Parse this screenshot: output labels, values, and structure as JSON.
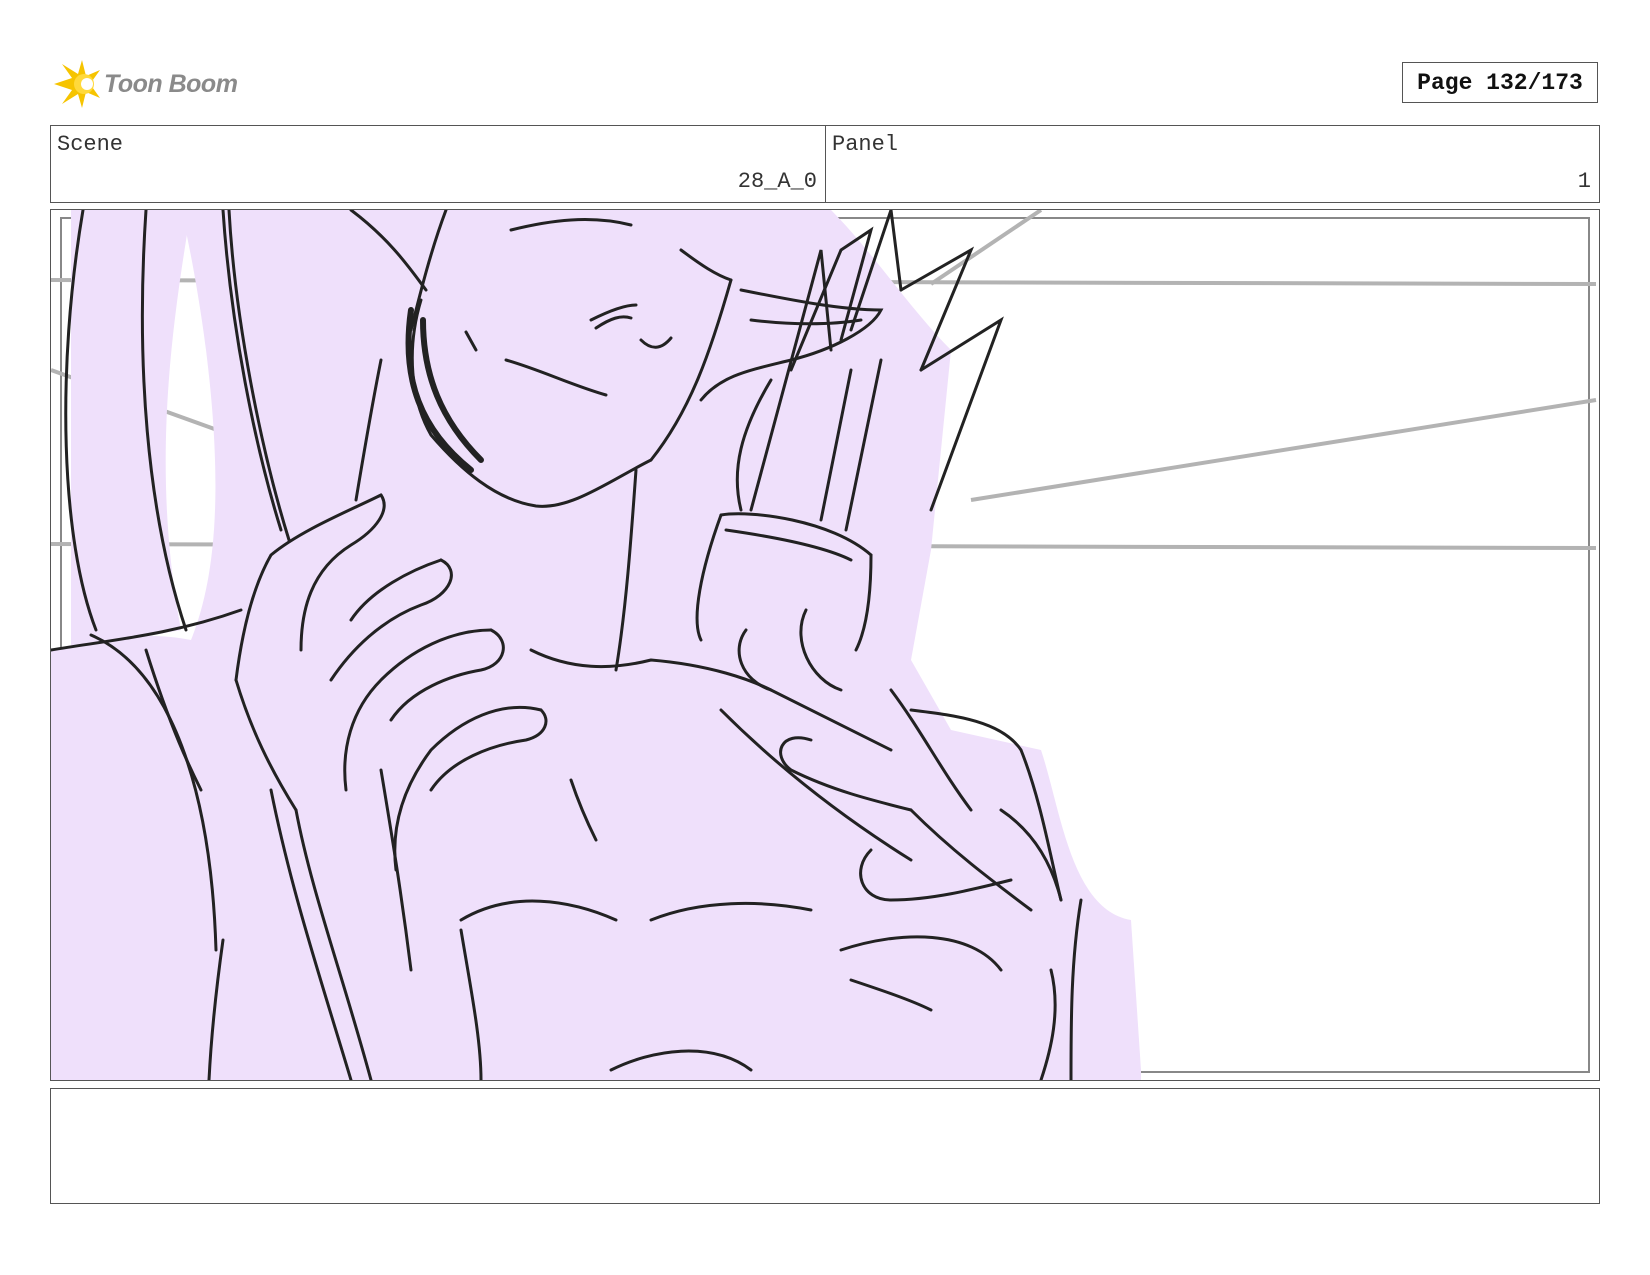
{
  "header": {
    "logo_text": "Toon Boom",
    "logo_icon": "toon-boom-flare-icon",
    "page_label": "Page 132/173"
  },
  "info": {
    "scene_label": "Scene",
    "scene_value": "28_A_0",
    "panel_label": "Panel",
    "panel_value": "1"
  },
  "artwork": {
    "description_icon": "storyboard-sketch",
    "fill_color": "#efe0fb",
    "line_color": "#222222",
    "guide_color": "#b3b3b3"
  },
  "notes": {
    "text": ""
  }
}
